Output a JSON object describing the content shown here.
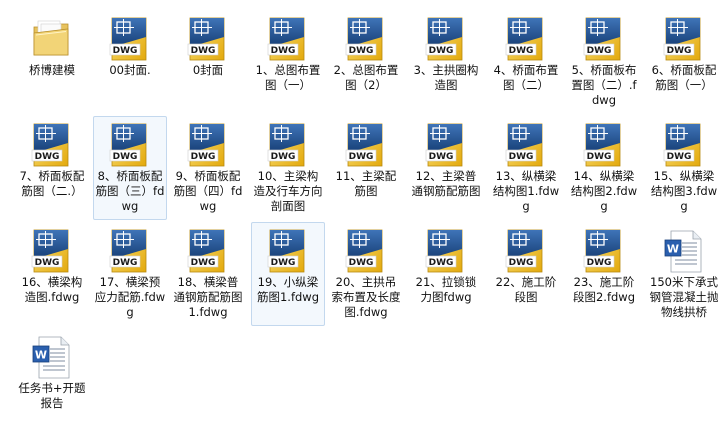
{
  "files": [
    {
      "name": "桥博建模",
      "type": "folder"
    },
    {
      "name": "00封面.",
      "type": "dwg"
    },
    {
      "name": "0封面",
      "type": "dwg"
    },
    {
      "name": "1、总图布置图（一）",
      "type": "dwg"
    },
    {
      "name": "2、总图布置图（2）",
      "type": "dwg"
    },
    {
      "name": "3、主拱圈构造图",
      "type": "dwg"
    },
    {
      "name": "4、桥面布置图（二）",
      "type": "dwg"
    },
    {
      "name": "5、桥面板布置图（二）.fdwg",
      "type": "dwg"
    },
    {
      "name": "6、桥面板配筋图（一）",
      "type": "dwg"
    },
    {
      "name": "7、桥面板配筋图（二.）",
      "type": "dwg"
    },
    {
      "name": "8、桥面板配筋图（三）fdwg",
      "type": "dwg",
      "selected": true
    },
    {
      "name": "9、桥面板配筋图（四）fdwg",
      "type": "dwg"
    },
    {
      "name": "10、主梁构造及行车方向剖面图",
      "type": "dwg"
    },
    {
      "name": "11、主梁配筋图",
      "type": "dwg"
    },
    {
      "name": "12、主梁普通钢筋配筋图",
      "type": "dwg"
    },
    {
      "name": "13、纵横梁结构图1.fdwg",
      "type": "dwg"
    },
    {
      "name": "14、纵横梁结构图2.fdwg",
      "type": "dwg"
    },
    {
      "name": "15、纵横梁结构图3.fdwg",
      "type": "dwg"
    },
    {
      "name": "16、横梁构造图.fdwg",
      "type": "dwg"
    },
    {
      "name": "17、横梁预应力配筋.fdwg",
      "type": "dwg"
    },
    {
      "name": "18、横梁普通钢筋配筋图1.fdwg",
      "type": "dwg"
    },
    {
      "name": "19、小纵梁筋图1.fdwg",
      "type": "dwg",
      "selected": true
    },
    {
      "name": "20、主拱吊索布置及长度图.fdwg",
      "type": "dwg"
    },
    {
      "name": "21、拉锁锁力图fdwg",
      "type": "dwg"
    },
    {
      "name": "22、施工阶段图",
      "type": "dwg"
    },
    {
      "name": "23、施工阶段图2.fdwg",
      "type": "dwg"
    },
    {
      "name": "150米下承式钢管混凝土抛物线拱桥",
      "type": "doc"
    },
    {
      "name": "任务书+开题报告",
      "type": "doc"
    }
  ],
  "icons": {
    "folder": "folder-icon",
    "dwg": "dwg-file-icon",
    "doc": "word-document-icon"
  },
  "dwg_badge": "DWG",
  "colors": {
    "selection_border": "#c3d8ee",
    "selection_fill": "#f3f8fd",
    "dwg_yellow": "#f4c21a",
    "dwg_blue": "#1f4e8c"
  }
}
